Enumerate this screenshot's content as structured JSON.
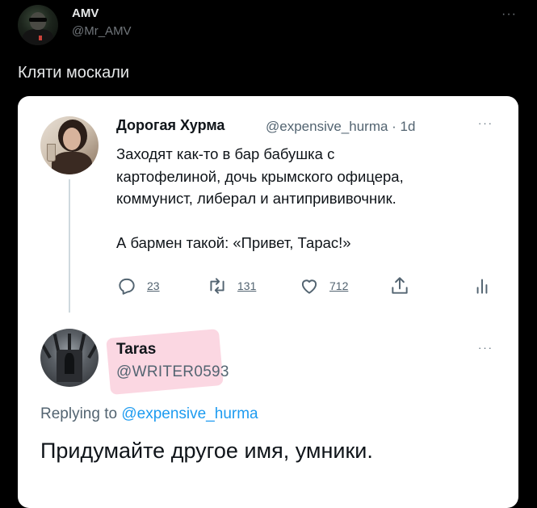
{
  "post": {
    "author_name": "AMV",
    "author_handle": "@Mr_AMV",
    "more_label": "···",
    "text": "Кляти москали"
  },
  "quoted_tweet": {
    "author_name": "Дорогая Хурма",
    "author_handle_time": "@expensive_hurma · 1d",
    "more_label": "···",
    "lines": [
      "Заходят как-то в бар бабушка с",
      "картофелиной, дочь крымского офицера,",
      "коммунист, либерал и антипрививочник."
    ],
    "punchline": "А бармен такой: «Привет, Тарас!»",
    "actions": {
      "reply_count": "23",
      "retweet_count": "131",
      "like_count": "712"
    }
  },
  "reply_tweet": {
    "author_name": "Taras",
    "author_handle": "@WRITER0593",
    "more_label": "···",
    "replying_prefix": "Replying to",
    "replying_mention": "@expensive_hurma",
    "text": "Придумайте другое имя, умники."
  },
  "colors": {
    "background": "#000000",
    "card": "#ffffff",
    "link": "#1d9bf0",
    "highlight": "#f7a6be"
  }
}
